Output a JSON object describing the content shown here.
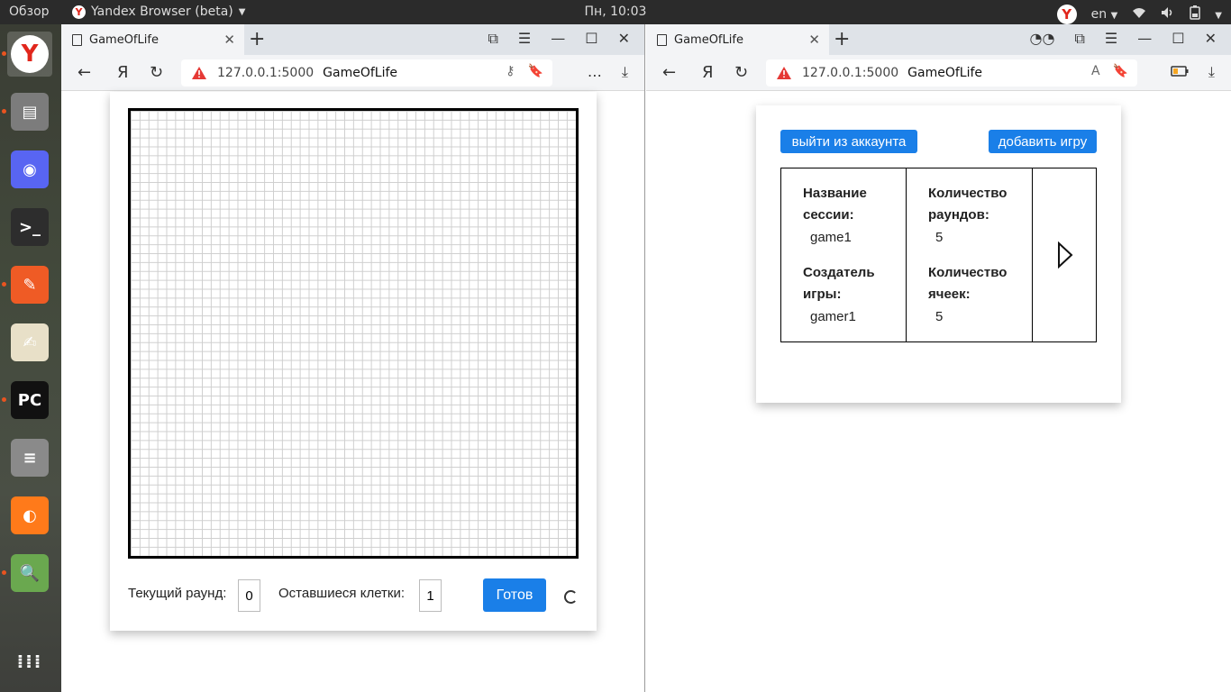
{
  "topbar": {
    "activities": "Обзор",
    "app_name": "Yandex Browser (beta)",
    "clock": "Пн, 10:03",
    "lang": "en"
  },
  "dock": {
    "items": [
      {
        "name": "yandex-browser-icon",
        "glyph": "Y",
        "color": "#e1261c"
      },
      {
        "name": "files-icon",
        "glyph": "▤",
        "color": "#7c7c7c"
      },
      {
        "name": "discord-icon",
        "glyph": "◉",
        "color": "#5865f2"
      },
      {
        "name": "terminal-icon",
        "glyph": ">_",
        "color": "#2d2d2d"
      },
      {
        "name": "postman-icon",
        "glyph": "✎",
        "color": "#ef5b25"
      },
      {
        "name": "text-editor-icon",
        "glyph": "✍",
        "color": "#e8e0c8"
      },
      {
        "name": "pycharm-icon",
        "glyph": "PC",
        "color": "#111111"
      },
      {
        "name": "database-icon",
        "glyph": "≡",
        "color": "#8a8a8a"
      },
      {
        "name": "firefox-icon",
        "glyph": "◐",
        "color": "#ff7a1a"
      },
      {
        "name": "image-viewer-icon",
        "glyph": "🔍",
        "color": "#6aa84f"
      },
      {
        "name": "show-apps-icon",
        "glyph": "⁞⁞⁞",
        "color": "transparent"
      }
    ]
  },
  "left_window": {
    "tab_title": "GameOfLife",
    "url": "127.0.0.1:5000",
    "page_title": "GameOfLife",
    "game": {
      "current_round_label": "Текущий раунд:",
      "current_round_value": "0",
      "remaining_cells_label": "Оставшиеся клетки:",
      "remaining_cells_value": "1",
      "ready_label": "Готов"
    }
  },
  "right_window": {
    "tab_title": "GameOfLife",
    "url": "127.0.0.1:5000",
    "page_title": "GameOfLife",
    "logout_label": "выйти из аккаунта",
    "add_game_label": "добавить игру",
    "session": {
      "name_label": "Название сессии:",
      "name_value": "game1",
      "creator_label": "Создатель игры:",
      "creator_value": "gamer1",
      "rounds_label": "Количество раундов:",
      "rounds_value": "5",
      "cells_label": "Количество ячеек:",
      "cells_value": "5"
    }
  },
  "colors": {
    "accent_blue": "#1a7fe8",
    "warning_red": "#e53935"
  }
}
